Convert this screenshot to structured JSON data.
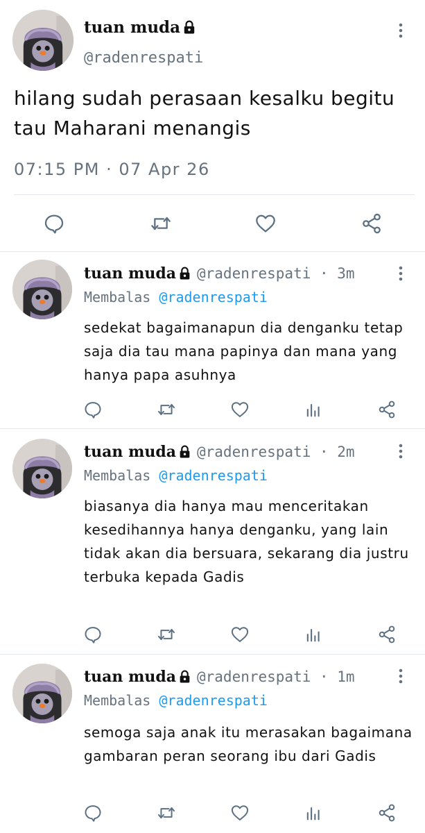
{
  "main_tweet": {
    "author_name": "tuan muda",
    "handle": "@radenrespati",
    "text": "hilang sudah perasaan kesalku begitu tau Maharani menangis",
    "timestamp": "07:15 PM · 07 Apr 26",
    "actions": [
      "reply-icon",
      "retweet-icon",
      "like-icon",
      "share-icon"
    ]
  },
  "replies": [
    {
      "author_name": "tuan muda",
      "handle_time": "@radenrespati · 3m",
      "replying_label": "Membalas",
      "replying_to": "@radenrespati",
      "text": "sedekat bagaimanapun dia denganku tetap saja dia tau mana papinya dan mana yang hanya papa asuhnya"
    },
    {
      "author_name": "tuan muda",
      "handle_time": "@radenrespati · 2m",
      "replying_label": "Membalas",
      "replying_to": "@radenrespati",
      "text": "biasanya dia hanya mau menceritakan kesedihannya hanya denganku, yang lain tidak akan dia bersuara, sekarang dia justru terbuka kepada Gadis"
    },
    {
      "author_name": "tuan muda",
      "handle_time": "@radenrespati · 1m",
      "replying_label": "Membalas",
      "replying_to": "@radenrespati",
      "text": "semoga saja anak itu merasakan bagaimana gambaran peran seorang ibu dari Gadis"
    }
  ],
  "reply_actions": [
    "reply-icon",
    "retweet-icon",
    "like-icon",
    "analytics-icon",
    "share-icon"
  ],
  "colors": {
    "text": "#111111",
    "secondary": "#66727e",
    "mention": "#1d9bf0",
    "divider": "#e3e6ea",
    "icon": "#5b7083"
  }
}
